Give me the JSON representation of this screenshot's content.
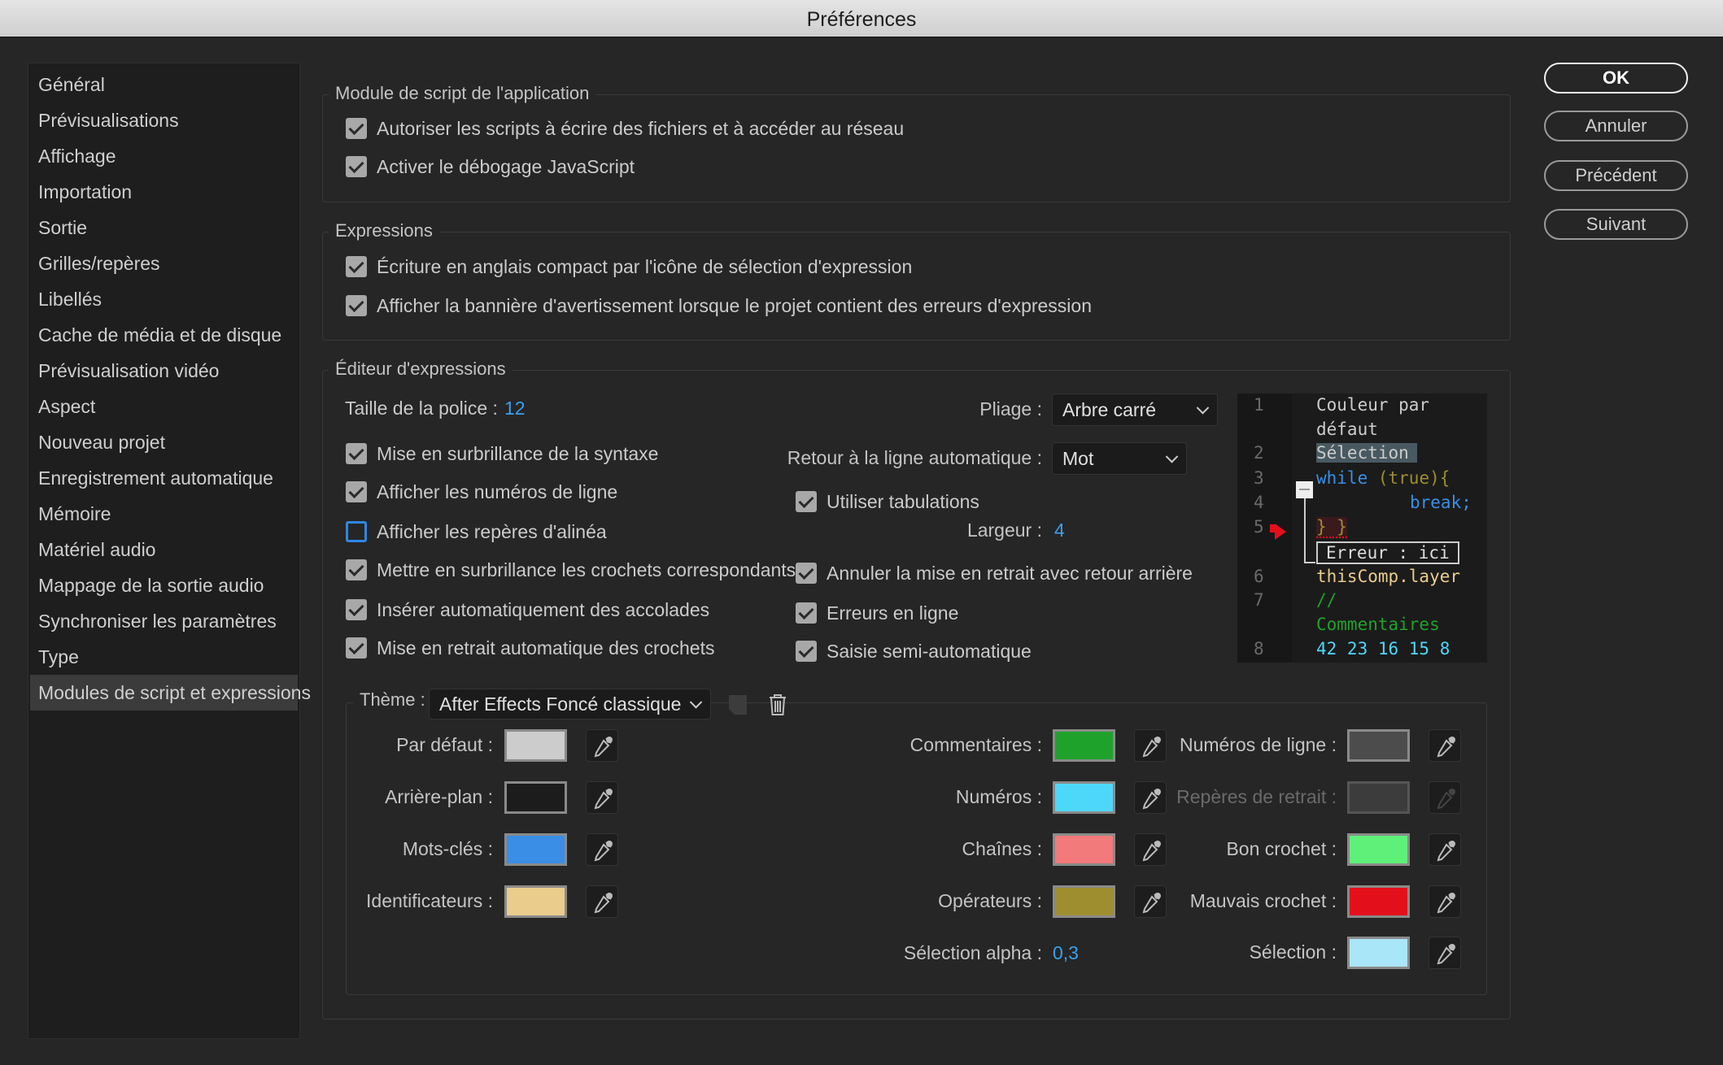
{
  "window": {
    "title": "Préférences"
  },
  "sidebar": {
    "selected": 18,
    "items": [
      "Général",
      "Prévisualisations",
      "Affichage",
      "Importation",
      "Sortie",
      "Grilles/repères",
      "Libellés",
      "Cache de média et de disque",
      "Prévisualisation vidéo",
      "Aspect",
      "Nouveau projet",
      "Enregistrement automatique",
      "Mémoire",
      "Matériel audio",
      "Mappage de la sortie audio",
      "Synchroniser les paramètres",
      "Type",
      "Modules de script et expressions"
    ]
  },
  "buttons": {
    "ok": "OK",
    "cancel": "Annuler",
    "previous": "Précédent",
    "next": "Suivant"
  },
  "scripting": {
    "title": "Module de script de l'application",
    "options": [
      {
        "label": "Autoriser les scripts à écrire des fichiers et à accéder au réseau",
        "checked": true
      },
      {
        "label": "Activer le débogage JavaScript",
        "checked": true
      }
    ]
  },
  "expressions": {
    "title": "Expressions",
    "options": [
      {
        "label": "Écriture en anglais compact par l'icône de sélection d'expression",
        "checked": true
      },
      {
        "label": "Afficher la bannière d'avertissement lorsque le projet contient des erreurs d'expression",
        "checked": true
      }
    ]
  },
  "editor": {
    "title": "Éditeur d'expressions",
    "font_size_label": "Taille de la police :",
    "font_size": "12",
    "left_options": [
      {
        "label": "Mise en surbrillance de la syntaxe",
        "checked": true
      },
      {
        "label": "Afficher les numéros de ligne",
        "checked": true
      },
      {
        "label": "Afficher les repères d'alinéa",
        "checked": false
      },
      {
        "label": "Mettre en surbrillance les crochets correspondants",
        "checked": true
      },
      {
        "label": "Insérer automatiquement des accolades",
        "checked": true
      },
      {
        "label": "Mise en retrait automatique des crochets",
        "checked": true
      }
    ],
    "folding_label": "Pliage :",
    "folding": "Arbre carré",
    "wrap_label": "Retour à la ligne automatique :",
    "wrap": "Mot",
    "right_options": [
      {
        "label": "Utiliser tabulations",
        "checked": true
      },
      {
        "label": "Annuler la mise en retrait avec retour arrière",
        "checked": true
      },
      {
        "label": "Erreurs en ligne",
        "checked": true
      },
      {
        "label": "Saisie semi-automatique",
        "checked": true
      }
    ],
    "width_label": "Largeur :",
    "width": "4",
    "preview": {
      "line_numbers": [
        "1",
        "2",
        "3",
        "4",
        "5",
        "6",
        "7",
        "8"
      ],
      "default_text": [
        "Couleur par",
        "défaut"
      ],
      "selection": "Sélection",
      "keyword_while": "while",
      "paren": "(true){",
      "keyword_break": "break;",
      "braces": "} }",
      "error": "Erreur : ici",
      "identifier": "thisComp.layer",
      "comment": [
        "//",
        "Commentaires"
      ],
      "numbers": "42 23 16 15 8"
    },
    "theme_label": "Thème :",
    "theme": "After Effects Foncé classique",
    "colors": [
      {
        "label": "Par défaut :",
        "color": "#cccccc",
        "col": 0,
        "row": 0
      },
      {
        "label": "Arrière-plan :",
        "color": "#1c1c1c",
        "col": 0,
        "row": 1
      },
      {
        "label": "Mots-clés :",
        "color": "#3a8ee6",
        "col": 0,
        "row": 2
      },
      {
        "label": "Identificateurs :",
        "color": "#eacc8c",
        "col": 0,
        "row": 3
      },
      {
        "label": "Commentaires :",
        "color": "#1fa22c",
        "col": 1,
        "row": 0
      },
      {
        "label": "Numéros :",
        "color": "#4dd8fa",
        "col": 1,
        "row": 1
      },
      {
        "label": "Chaînes :",
        "color": "#f27a7a",
        "col": 1,
        "row": 2
      },
      {
        "label": "Opérateurs :",
        "color": "#9e8e2f",
        "col": 1,
        "row": 3
      },
      {
        "label": "Numéros de ligne :",
        "color": "#4c4c4c",
        "col": 2,
        "row": 0
      },
      {
        "label": "Repères de retrait :",
        "color": "#3c3c3c",
        "col": 2,
        "row": 1,
        "disabled": true
      },
      {
        "label": "Bon crochet :",
        "color": "#5ff07a",
        "col": 2,
        "row": 2
      },
      {
        "label": "Mauvais crochet :",
        "color": "#e3101b",
        "col": 2,
        "row": 3
      },
      {
        "label": "Sélection :",
        "color": "#a9e6f7",
        "col": 2,
        "row": 4
      }
    ],
    "selection_alpha_label": "Sélection alpha :",
    "selection_alpha": "0,3"
  }
}
